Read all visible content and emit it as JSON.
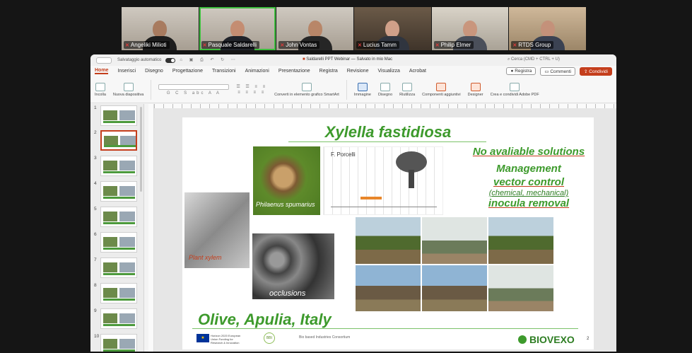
{
  "participants": [
    {
      "name": "Angeliki Milioti"
    },
    {
      "name": "Pasquale Saldarelli"
    },
    {
      "name": "John Vontas"
    },
    {
      "name": "Lucius Tamm"
    },
    {
      "name": "Philip Elmer"
    },
    {
      "name": "RTDS Group"
    }
  ],
  "app": {
    "autosave_label": "Salvataggio automatico",
    "doc_title": "Saldarelli PPT Webinar — Salvato in mio Mac",
    "search_placeholder": "Cerca (CMD + CTRL + U)"
  },
  "ribbon": {
    "tabs": [
      "Home",
      "Inserisci",
      "Disegno",
      "Progettazione",
      "Transizioni",
      "Animazioni",
      "Presentazione",
      "Registra",
      "Revisione",
      "Visualizza",
      "Acrobat"
    ],
    "active_tab": "Home",
    "record_label": "Registra",
    "comments_label": "Commenti",
    "share_label": "Condividi",
    "groups": {
      "paste": "Incolla",
      "new_slide": "Nuova diapositiva",
      "smartart": "Converti in elemento grafico SmartArt",
      "image": "Immagine",
      "draw": "Disegno",
      "reuse": "Riutilizza",
      "addins": "Componenti aggiuntivi",
      "designer": "Designer",
      "pdf": "Crea e condividi Adobe PDF"
    }
  },
  "thumbnails": [
    "1",
    "2",
    "3",
    "4",
    "5",
    "6",
    "7",
    "8",
    "9",
    "10"
  ],
  "selected_thumbnail": "2",
  "slide": {
    "title": "Xylella fastidiosa",
    "no_solutions": "No avaliable solutions",
    "management": "Management",
    "vector_control": "vector control",
    "chemical_mechanical": "(chemical, mechanical)",
    "inocula_removal": "inocula removal",
    "insect_caption": "Philaenus spumarius",
    "graph_caption": "F. Porcelli",
    "xylem_caption": "Plant xylem",
    "occlusions_caption": "occlusions",
    "bottom_title": "Olive, Apulia, Italy",
    "footer": {
      "eu_text": "Horizon 2020 European Union Funding for Research & Innovation",
      "bbi": "BBI",
      "bbi_text": "Bio based Industries Consortium",
      "brand": "BIOVEXO",
      "page": "2"
    }
  }
}
